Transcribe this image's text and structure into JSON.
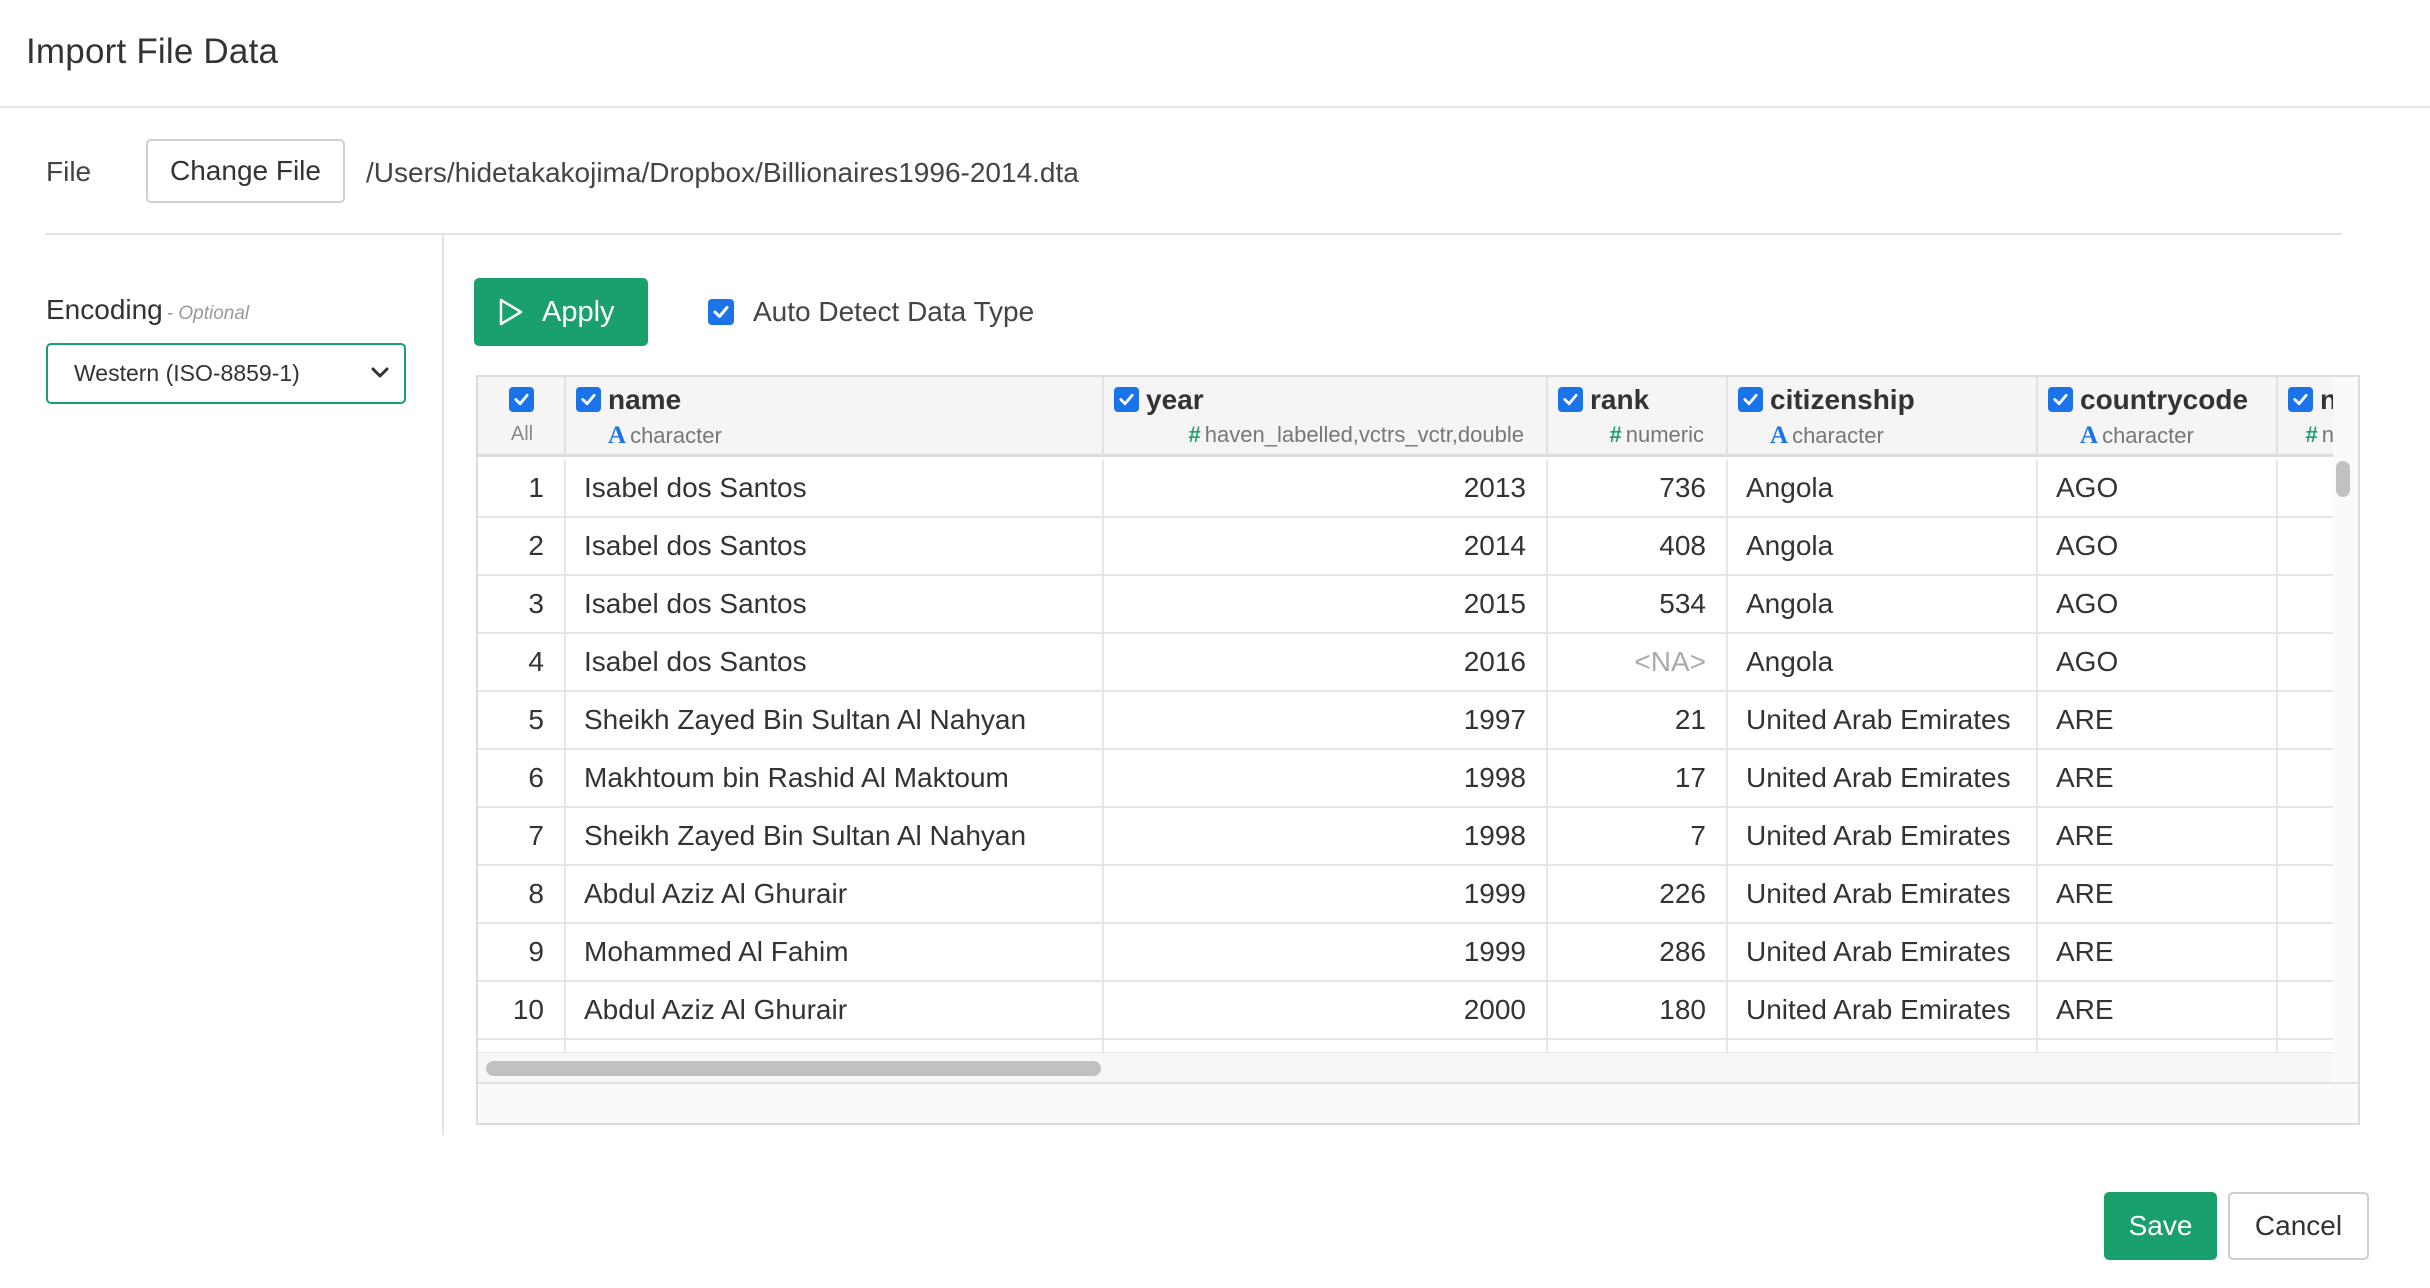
{
  "dialog": {
    "title": "Import File Data"
  },
  "file": {
    "label": "File",
    "change_button": "Change File",
    "path": "/Users/hidetakakojima/Dropbox/Billionaires1996-2014.dta"
  },
  "encoding": {
    "label": "Encoding",
    "optional": "- Optional",
    "selected": "Western (ISO-8859-1)"
  },
  "toolbar": {
    "apply_label": "Apply",
    "auto_detect_label": "Auto Detect Data Type",
    "auto_detect_checked": true
  },
  "grid": {
    "all_label": "All",
    "columns": [
      {
        "name": "name",
        "type": "character",
        "type_icon": "A"
      },
      {
        "name": "year",
        "type": "haven_labelled,vctrs_vctr,double",
        "type_icon": "#"
      },
      {
        "name": "rank",
        "type": "numeric",
        "type_icon": "#"
      },
      {
        "name": "citizenship",
        "type": "character",
        "type_icon": "A"
      },
      {
        "name": "countrycode",
        "type": "character",
        "type_icon": "A"
      },
      {
        "name": "ne",
        "type": "n",
        "type_icon": "#"
      }
    ],
    "rows": [
      {
        "idx": "1",
        "name": "Isabel dos Santos",
        "year": "2013",
        "rank": "736",
        "citizenship": "Angola",
        "countrycode": "AGO"
      },
      {
        "idx": "2",
        "name": "Isabel dos Santos",
        "year": "2014",
        "rank": "408",
        "citizenship": "Angola",
        "countrycode": "AGO"
      },
      {
        "idx": "3",
        "name": "Isabel dos Santos",
        "year": "2015",
        "rank": "534",
        "citizenship": "Angola",
        "countrycode": "AGO"
      },
      {
        "idx": "4",
        "name": "Isabel dos Santos",
        "year": "2016",
        "rank": "<NA>",
        "citizenship": "Angola",
        "countrycode": "AGO"
      },
      {
        "idx": "5",
        "name": "Sheikh Zayed Bin Sultan Al Nahyan",
        "year": "1997",
        "rank": "21",
        "citizenship": "United Arab Emirates",
        "countrycode": "ARE"
      },
      {
        "idx": "6",
        "name": "Makhtoum bin Rashid Al Maktoum",
        "year": "1998",
        "rank": "17",
        "citizenship": "United Arab Emirates",
        "countrycode": "ARE"
      },
      {
        "idx": "7",
        "name": "Sheikh Zayed Bin Sultan Al Nahyan",
        "year": "1998",
        "rank": "7",
        "citizenship": "United Arab Emirates",
        "countrycode": "ARE"
      },
      {
        "idx": "8",
        "name": "Abdul Aziz Al Ghurair",
        "year": "1999",
        "rank": "226",
        "citizenship": "United Arab Emirates",
        "countrycode": "ARE"
      },
      {
        "idx": "9",
        "name": "Mohammed Al Fahim",
        "year": "1999",
        "rank": "286",
        "citizenship": "United Arab Emirates",
        "countrycode": "ARE"
      },
      {
        "idx": "10",
        "name": "Abdul Aziz Al Ghurair",
        "year": "2000",
        "rank": "180",
        "citizenship": "United Arab Emirates",
        "countrycode": "ARE"
      }
    ]
  },
  "footer": {
    "save_label": "Save",
    "cancel_label": "Cancel"
  },
  "colors": {
    "accent_green": "#1aa06d",
    "checkbox_blue": "#1a73e8"
  }
}
